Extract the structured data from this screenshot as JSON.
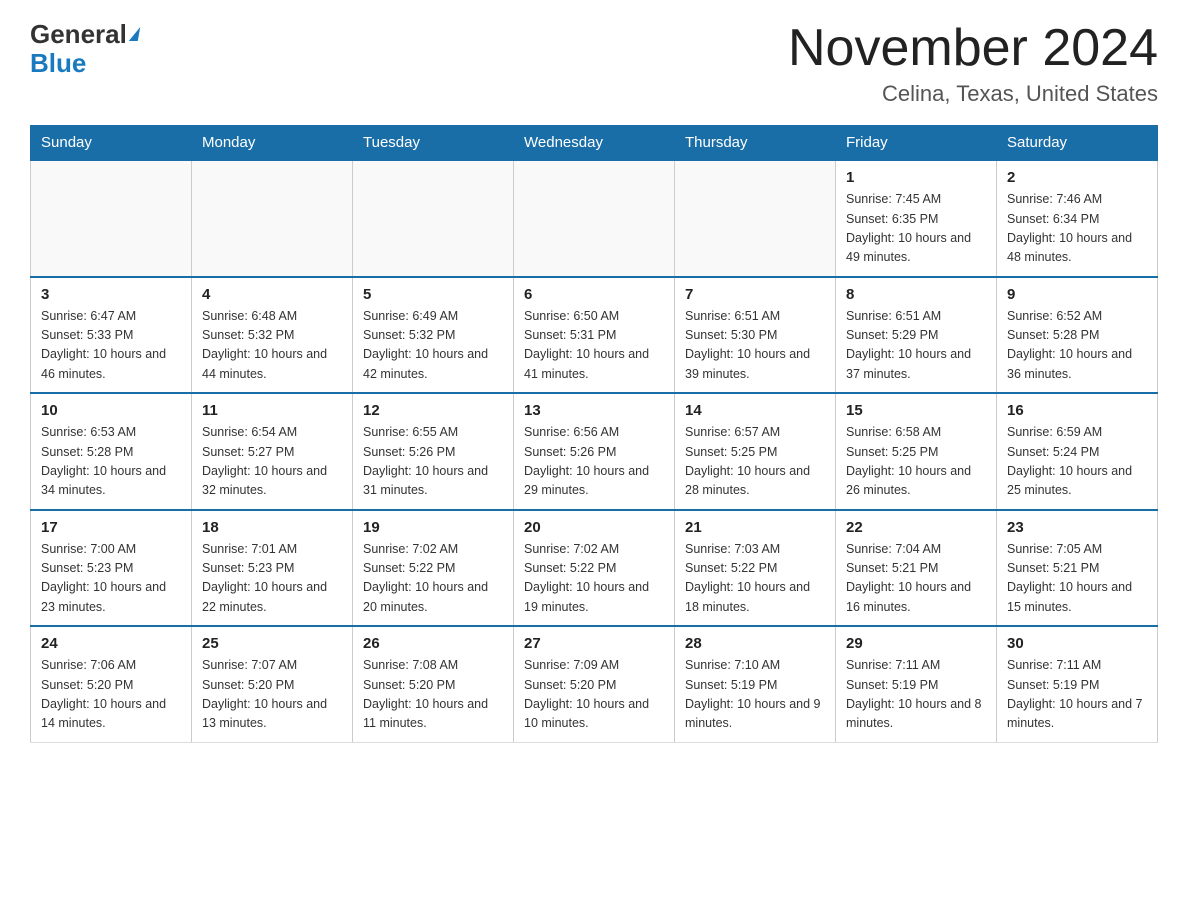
{
  "header": {
    "logo_general": "General",
    "logo_blue": "Blue",
    "month_title": "November 2024",
    "location": "Celina, Texas, United States"
  },
  "weekdays": [
    "Sunday",
    "Monday",
    "Tuesday",
    "Wednesday",
    "Thursday",
    "Friday",
    "Saturday"
  ],
  "weeks": [
    [
      {
        "day": "",
        "info": ""
      },
      {
        "day": "",
        "info": ""
      },
      {
        "day": "",
        "info": ""
      },
      {
        "day": "",
        "info": ""
      },
      {
        "day": "",
        "info": ""
      },
      {
        "day": "1",
        "info": "Sunrise: 7:45 AM\nSunset: 6:35 PM\nDaylight: 10 hours and 49 minutes."
      },
      {
        "day": "2",
        "info": "Sunrise: 7:46 AM\nSunset: 6:34 PM\nDaylight: 10 hours and 48 minutes."
      }
    ],
    [
      {
        "day": "3",
        "info": "Sunrise: 6:47 AM\nSunset: 5:33 PM\nDaylight: 10 hours and 46 minutes."
      },
      {
        "day": "4",
        "info": "Sunrise: 6:48 AM\nSunset: 5:32 PM\nDaylight: 10 hours and 44 minutes."
      },
      {
        "day": "5",
        "info": "Sunrise: 6:49 AM\nSunset: 5:32 PM\nDaylight: 10 hours and 42 minutes."
      },
      {
        "day": "6",
        "info": "Sunrise: 6:50 AM\nSunset: 5:31 PM\nDaylight: 10 hours and 41 minutes."
      },
      {
        "day": "7",
        "info": "Sunrise: 6:51 AM\nSunset: 5:30 PM\nDaylight: 10 hours and 39 minutes."
      },
      {
        "day": "8",
        "info": "Sunrise: 6:51 AM\nSunset: 5:29 PM\nDaylight: 10 hours and 37 minutes."
      },
      {
        "day": "9",
        "info": "Sunrise: 6:52 AM\nSunset: 5:28 PM\nDaylight: 10 hours and 36 minutes."
      }
    ],
    [
      {
        "day": "10",
        "info": "Sunrise: 6:53 AM\nSunset: 5:28 PM\nDaylight: 10 hours and 34 minutes."
      },
      {
        "day": "11",
        "info": "Sunrise: 6:54 AM\nSunset: 5:27 PM\nDaylight: 10 hours and 32 minutes."
      },
      {
        "day": "12",
        "info": "Sunrise: 6:55 AM\nSunset: 5:26 PM\nDaylight: 10 hours and 31 minutes."
      },
      {
        "day": "13",
        "info": "Sunrise: 6:56 AM\nSunset: 5:26 PM\nDaylight: 10 hours and 29 minutes."
      },
      {
        "day": "14",
        "info": "Sunrise: 6:57 AM\nSunset: 5:25 PM\nDaylight: 10 hours and 28 minutes."
      },
      {
        "day": "15",
        "info": "Sunrise: 6:58 AM\nSunset: 5:25 PM\nDaylight: 10 hours and 26 minutes."
      },
      {
        "day": "16",
        "info": "Sunrise: 6:59 AM\nSunset: 5:24 PM\nDaylight: 10 hours and 25 minutes."
      }
    ],
    [
      {
        "day": "17",
        "info": "Sunrise: 7:00 AM\nSunset: 5:23 PM\nDaylight: 10 hours and 23 minutes."
      },
      {
        "day": "18",
        "info": "Sunrise: 7:01 AM\nSunset: 5:23 PM\nDaylight: 10 hours and 22 minutes."
      },
      {
        "day": "19",
        "info": "Sunrise: 7:02 AM\nSunset: 5:22 PM\nDaylight: 10 hours and 20 minutes."
      },
      {
        "day": "20",
        "info": "Sunrise: 7:02 AM\nSunset: 5:22 PM\nDaylight: 10 hours and 19 minutes."
      },
      {
        "day": "21",
        "info": "Sunrise: 7:03 AM\nSunset: 5:22 PM\nDaylight: 10 hours and 18 minutes."
      },
      {
        "day": "22",
        "info": "Sunrise: 7:04 AM\nSunset: 5:21 PM\nDaylight: 10 hours and 16 minutes."
      },
      {
        "day": "23",
        "info": "Sunrise: 7:05 AM\nSunset: 5:21 PM\nDaylight: 10 hours and 15 minutes."
      }
    ],
    [
      {
        "day": "24",
        "info": "Sunrise: 7:06 AM\nSunset: 5:20 PM\nDaylight: 10 hours and 14 minutes."
      },
      {
        "day": "25",
        "info": "Sunrise: 7:07 AM\nSunset: 5:20 PM\nDaylight: 10 hours and 13 minutes."
      },
      {
        "day": "26",
        "info": "Sunrise: 7:08 AM\nSunset: 5:20 PM\nDaylight: 10 hours and 11 minutes."
      },
      {
        "day": "27",
        "info": "Sunrise: 7:09 AM\nSunset: 5:20 PM\nDaylight: 10 hours and 10 minutes."
      },
      {
        "day": "28",
        "info": "Sunrise: 7:10 AM\nSunset: 5:19 PM\nDaylight: 10 hours and 9 minutes."
      },
      {
        "day": "29",
        "info": "Sunrise: 7:11 AM\nSunset: 5:19 PM\nDaylight: 10 hours and 8 minutes."
      },
      {
        "day": "30",
        "info": "Sunrise: 7:11 AM\nSunset: 5:19 PM\nDaylight: 10 hours and 7 minutes."
      }
    ]
  ]
}
